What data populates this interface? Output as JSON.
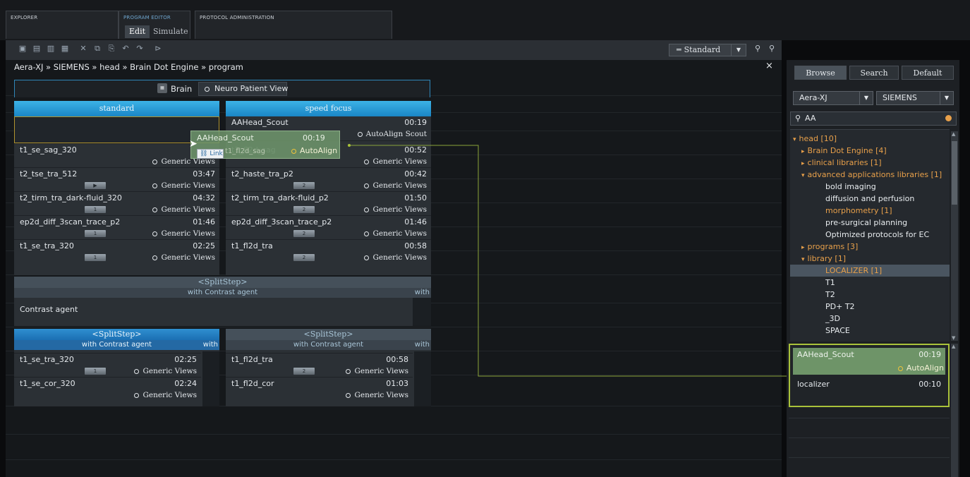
{
  "tabs": [
    {
      "label": "EXPLORER"
    },
    {
      "label": "PROGRAM EDITOR",
      "subtabs": [
        "Edit",
        "Simulate"
      ]
    },
    {
      "label": "PROTOCOL ADMINISTRATION"
    }
  ],
  "toolbar": {
    "view_select": "Standard"
  },
  "breadcrumb": "Aera-XJ » SIEMENS » head » Brain Dot Engine » program",
  "close_label": "×",
  "header_strip": {
    "brain_label": "Brain",
    "neuro_label": "Neuro Patient View"
  },
  "left_column": {
    "header": "standard",
    "rows": [
      {
        "name": "t1_se_sag_320",
        "time": "",
        "action": "Generic Views",
        "badge": ""
      },
      {
        "name": "t2_tse_tra_512",
        "time": "03:47",
        "action": "Generic Views",
        "badge": "▶"
      },
      {
        "name": "t2_tirm_tra_dark-fluid_320",
        "time": "04:32",
        "action": "Generic Views",
        "badge": "1"
      },
      {
        "name": "ep2d_diff_3scan_trace_p2",
        "time": "01:46",
        "action": "Generic Views",
        "badge": "1"
      },
      {
        "name": "t1_se_tra_320",
        "time": "02:25",
        "action": "Generic Views",
        "badge": "1"
      }
    ]
  },
  "right_column": {
    "header": "speed focus",
    "rows": [
      {
        "name": "AAHead_Scout",
        "time": "00:19",
        "action": "AutoAlign Scout",
        "badge": ""
      },
      {
        "name": "t1_fl2d_sag",
        "time": "00:52",
        "action": "Generic Views",
        "badge": ""
      },
      {
        "name": "t2_haste_tra_p2",
        "time": "00:42",
        "action": "Generic Views",
        "badge": "2"
      },
      {
        "name": "t2_tirm_tra_dark-fluid_p2",
        "time": "01:50",
        "action": "Generic Views",
        "badge": "2"
      },
      {
        "name": "ep2d_diff_3scan_trace_p2",
        "time": "01:46",
        "action": "Generic Views",
        "badge": "2"
      },
      {
        "name": "t1_fl2d_tra",
        "time": "00:58",
        "action": "Generic Views",
        "badge": "2"
      }
    ]
  },
  "drag_item": {
    "name": "AAHead_Scout",
    "time": "00:19",
    "action": "AutoAlign",
    "link_label": "Link",
    "under_text": "t1_fl2d_sag"
  },
  "split_step": {
    "label": "<SplitStep>",
    "sub": "with Contrast agent",
    "sub_short": "with",
    "content": "Contrast agent"
  },
  "bottom_left": {
    "rows": [
      {
        "name": "t1_se_tra_320",
        "time": "02:25",
        "action": "Generic Views",
        "badge": "1"
      },
      {
        "name": "t1_se_cor_320",
        "time": "02:24",
        "action": "Generic Views",
        "badge": ""
      }
    ]
  },
  "bottom_right": {
    "rows": [
      {
        "name": "t1_fl2d_tra",
        "time": "00:58",
        "action": "Generic Views",
        "badge": "2"
      },
      {
        "name": "t1_fl2d_cor",
        "time": "01:03",
        "action": "Generic Views",
        "badge": ""
      }
    ]
  },
  "browser": {
    "tabs": [
      "Browse",
      "Search",
      "Default"
    ],
    "scanner": "Aera-XJ",
    "vendor": "SIEMENS",
    "search": "AA",
    "tree": [
      {
        "label": "head [10]",
        "indent": 0,
        "color": "orange",
        "arrow": "▾"
      },
      {
        "label": "Brain Dot Engine [4]",
        "indent": 1,
        "color": "orange",
        "arrow": "▸"
      },
      {
        "label": "clinical libraries [1]",
        "indent": 1,
        "color": "orange",
        "arrow": "▸"
      },
      {
        "label": "advanced applications libraries [1]",
        "indent": 1,
        "color": "orange",
        "arrow": "▾"
      },
      {
        "label": "bold imaging",
        "indent": 2,
        "color": "white",
        "arrow": ""
      },
      {
        "label": "diffusion and perfusion",
        "indent": 2,
        "color": "white",
        "arrow": ""
      },
      {
        "label": "morphometry [1]",
        "indent": 2,
        "color": "orange",
        "arrow": ""
      },
      {
        "label": "pre-surgical planning",
        "indent": 2,
        "color": "white",
        "arrow": ""
      },
      {
        "label": "Optimized protocols for EC",
        "indent": 2,
        "color": "white",
        "arrow": ""
      },
      {
        "label": "programs [3]",
        "indent": 1,
        "color": "orange",
        "arrow": "▸"
      },
      {
        "label": "library [1]",
        "indent": 1,
        "color": "orange",
        "arrow": "▾"
      },
      {
        "label": "LOCALIZER [1]",
        "indent": 2,
        "color": "orange",
        "arrow": "",
        "selected": true
      },
      {
        "label": "T1",
        "indent": 2,
        "color": "white",
        "arrow": ""
      },
      {
        "label": "T2",
        "indent": 2,
        "color": "white",
        "arrow": ""
      },
      {
        "label": "PD+ T2",
        "indent": 2,
        "color": "white",
        "arrow": ""
      },
      {
        "label": "_3D",
        "indent": 2,
        "color": "white",
        "arrow": ""
      },
      {
        "label": "SPACE",
        "indent": 2,
        "color": "white",
        "arrow": ""
      }
    ],
    "results": [
      {
        "name": "AAHead_Scout",
        "time": "00:19",
        "action": "AutoAlign"
      },
      {
        "name": "localizer",
        "time": "00:10",
        "action": ""
      }
    ]
  },
  "colors": {
    "accent_blue": "#2f86b8",
    "highlight_green": "#a9c23a",
    "tree_orange": "#e8a04a"
  }
}
